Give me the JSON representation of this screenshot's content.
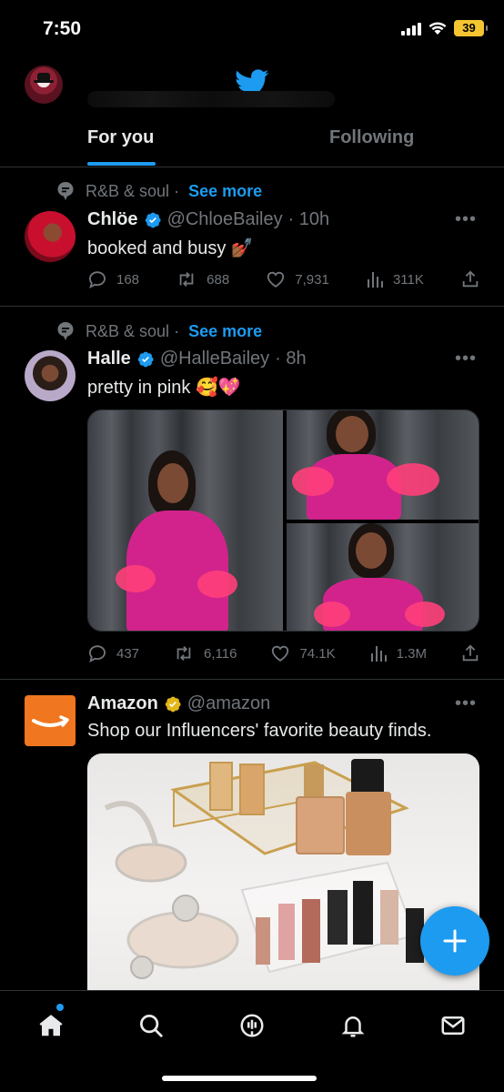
{
  "status_bar": {
    "time": "7:50",
    "battery": "39"
  },
  "tabs": [
    {
      "label": "For you",
      "selected": true
    },
    {
      "label": "Following",
      "selected": false
    }
  ],
  "tweets": [
    {
      "context_topic": "R&B & soul",
      "context_separator": "·",
      "see_more": "See more",
      "name": "Chlöe",
      "handle": "@ChloeBailey",
      "time": "· 10h",
      "text": "booked and busy 💅🏾",
      "replies": "168",
      "retweets": "688",
      "likes": "7,931",
      "views": "311K"
    },
    {
      "context_topic": "R&B & soul",
      "context_separator": "·",
      "see_more": "See more",
      "name": "Halle",
      "handle": "@HalleBailey",
      "time": "· 8h",
      "text": "pretty in pink 🥰💖",
      "replies": "437",
      "retweets": "6,116",
      "likes": "74.1K",
      "views": "1.3M"
    },
    {
      "name": "Amazon",
      "handle": "@amazon",
      "text": "Shop our Influencers' favorite beauty finds."
    }
  ],
  "more_label": "•••",
  "colors": {
    "accent": "#1d9bf0",
    "verified_gold": "#e2b719",
    "amazon_orange": "#f0761f"
  },
  "bottom_nav": [
    "home-icon",
    "search-icon",
    "spaces-icon",
    "notifications-icon",
    "messages-icon"
  ]
}
